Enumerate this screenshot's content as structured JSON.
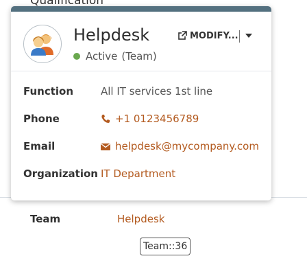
{
  "background": {
    "section_title": "Qualification",
    "team_label": "Team",
    "team_value": "Helpdesk",
    "friendly_tag": "Team::36"
  },
  "card": {
    "title": "Helpdesk",
    "status": "Active",
    "type": "(Team)",
    "modify_label": "MODIFY...",
    "fields": {
      "function": {
        "label": "Function",
        "value": "All IT services 1st line"
      },
      "phone": {
        "label": "Phone",
        "value": "+1 0123456789"
      },
      "email": {
        "label": "Email",
        "value": "helpdesk@mycompany.com"
      },
      "organization": {
        "label": "Organization",
        "value": "IT Department"
      }
    }
  },
  "colors": {
    "topbar": "#53707f",
    "link": "#b35a1f",
    "status_active": "#6aa84f"
  },
  "icons": {
    "avatar": "team-avatar-icon",
    "modify": "external-link-icon",
    "menu": "caret-down-icon",
    "phone": "phone-icon",
    "email": "envelope-icon"
  }
}
